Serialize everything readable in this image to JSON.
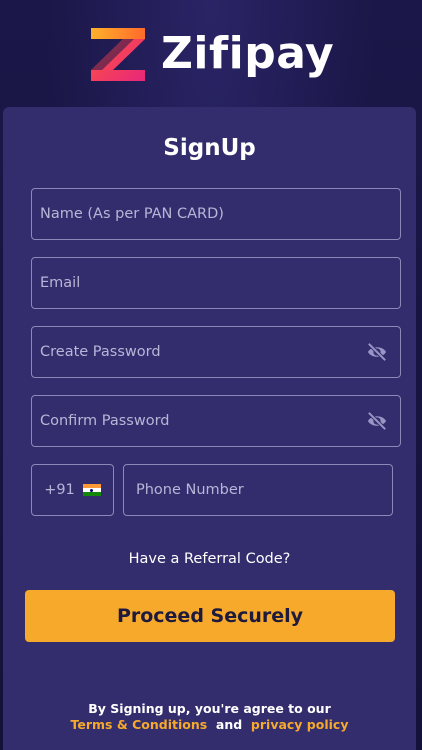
{
  "brand": {
    "name": "Zifipay",
    "colors": {
      "accent": "#f6a92a",
      "card": "#332d6e",
      "background": "#15123d"
    }
  },
  "form": {
    "title": "SignUp",
    "fields": {
      "name": {
        "placeholder": "Name (As per PAN CARD)",
        "value": ""
      },
      "email": {
        "placeholder": "Email",
        "value": ""
      },
      "create_password": {
        "placeholder": "Create Password",
        "value": "",
        "icon": "eye-off-icon"
      },
      "confirm_password": {
        "placeholder": "Confirm Password",
        "value": "",
        "icon": "eye-off-icon"
      },
      "country_code": {
        "value": "+91",
        "icon": "india-flag-icon"
      },
      "phone": {
        "placeholder": "Phone Number",
        "value": ""
      }
    },
    "referral_label": "Have a Referral Code?",
    "submit_label": "Proceed Securely",
    "terms": {
      "prefix": "By Signing up, you're agree to our",
      "terms_link": "Terms & Conditions",
      "conjunction": "and",
      "privacy_link": "privacy policy"
    }
  }
}
